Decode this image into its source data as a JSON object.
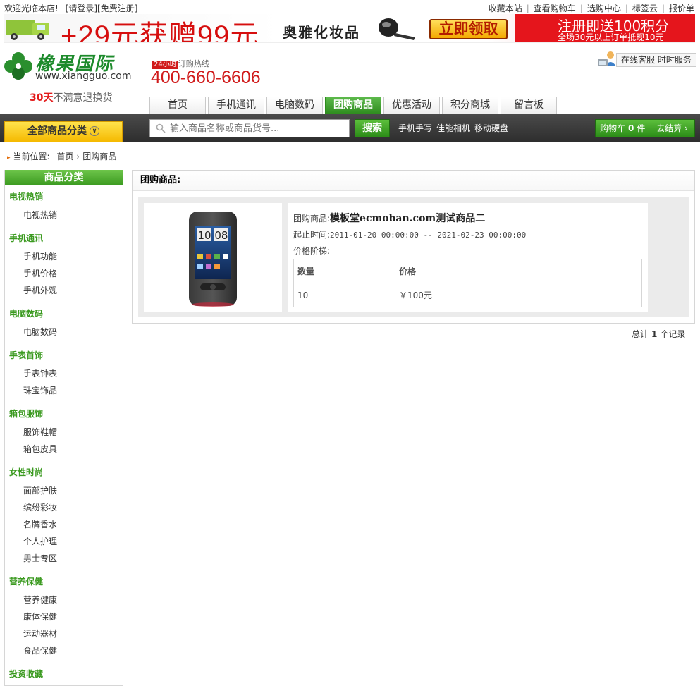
{
  "topbar": {
    "welcome": "欢迎光临本店!",
    "login": "[请登录]",
    "register": "[免费注册]",
    "links": [
      "收藏本站",
      "查看购物车",
      "选购中心",
      "标签云",
      "报价单"
    ]
  },
  "banner": {
    "promo": "+29元获赠99元",
    "brand": "奥雅化妆品",
    "button": "立即领取",
    "reg_line1": "注册即送100积分",
    "reg_line2": "全场30元以上订单抵现10元"
  },
  "logo": {
    "name": "橡果国际",
    "url": "www.xiangguo.com",
    "guarantee_days": "30天",
    "guarantee_text": "不满意退换货"
  },
  "hotline": {
    "tag": "24小时",
    "label": "订购热线",
    "number": "400-660-6606"
  },
  "service": {
    "label": "在线客服  时时服务"
  },
  "nav": {
    "tabs": [
      "首页",
      "手机通讯",
      "电脑数码",
      "团购商品",
      "优惠活动",
      "积分商城",
      "留言板"
    ],
    "active": "团购商品"
  },
  "search": {
    "category_button": "全部商品分类",
    "placeholder": "输入商品名称或商品货号...",
    "button": "搜索",
    "hot_keywords": [
      "手机手写",
      "佳能相机",
      "移动硬盘"
    ],
    "cart_label": "购物车",
    "cart_count": "0",
    "cart_unit": "件",
    "checkout": "去结算 ›"
  },
  "breadcrumb": {
    "prefix": "当前位置:",
    "home": "首页",
    "current": "团购商品"
  },
  "categories": {
    "title": "商品分类",
    "groups": [
      {
        "title": "电视热销",
        "items": [
          "电视热销"
        ]
      },
      {
        "title": "手机通讯",
        "items": [
          "手机功能",
          "手机价格",
          "手机外观"
        ]
      },
      {
        "title": "电脑数码",
        "items": [
          "电脑数码"
        ]
      },
      {
        "title": "手表首饰",
        "items": [
          "手表钟表",
          "珠宝饰品"
        ]
      },
      {
        "title": "箱包服饰",
        "items": [
          "服饰鞋帽",
          "箱包皮具"
        ]
      },
      {
        "title": "女性时尚",
        "items": [
          "面部护肤",
          "缤纷彩妆",
          "名牌香水",
          "个人护理",
          "男士专区"
        ]
      },
      {
        "title": "营养保健",
        "items": [
          "营养健康",
          "康体保健",
          "运动器材",
          "食品保健"
        ]
      },
      {
        "title": "投资收藏",
        "items": []
      }
    ]
  },
  "main": {
    "title": "团购商品:",
    "goods_label": "团购商品:",
    "goods_name": "模板堂ecmoban.com测试商品二",
    "period_label": "起止时间:",
    "period_value": "2011-01-20 00:00:00 -- 2021-02-23 00:00:00",
    "ladder_label": "价格阶梯:",
    "table_headers": [
      "数量",
      "价格"
    ],
    "table_rows": [
      [
        "10",
        "￥100元"
      ]
    ],
    "phone_time": "10 08"
  },
  "total": {
    "prefix": "总计",
    "count": "1",
    "suffix": "个记录"
  },
  "colors": {
    "accent_green": "#3b9a20",
    "accent_red": "#d01b1b",
    "yellow": "#f5b900"
  }
}
